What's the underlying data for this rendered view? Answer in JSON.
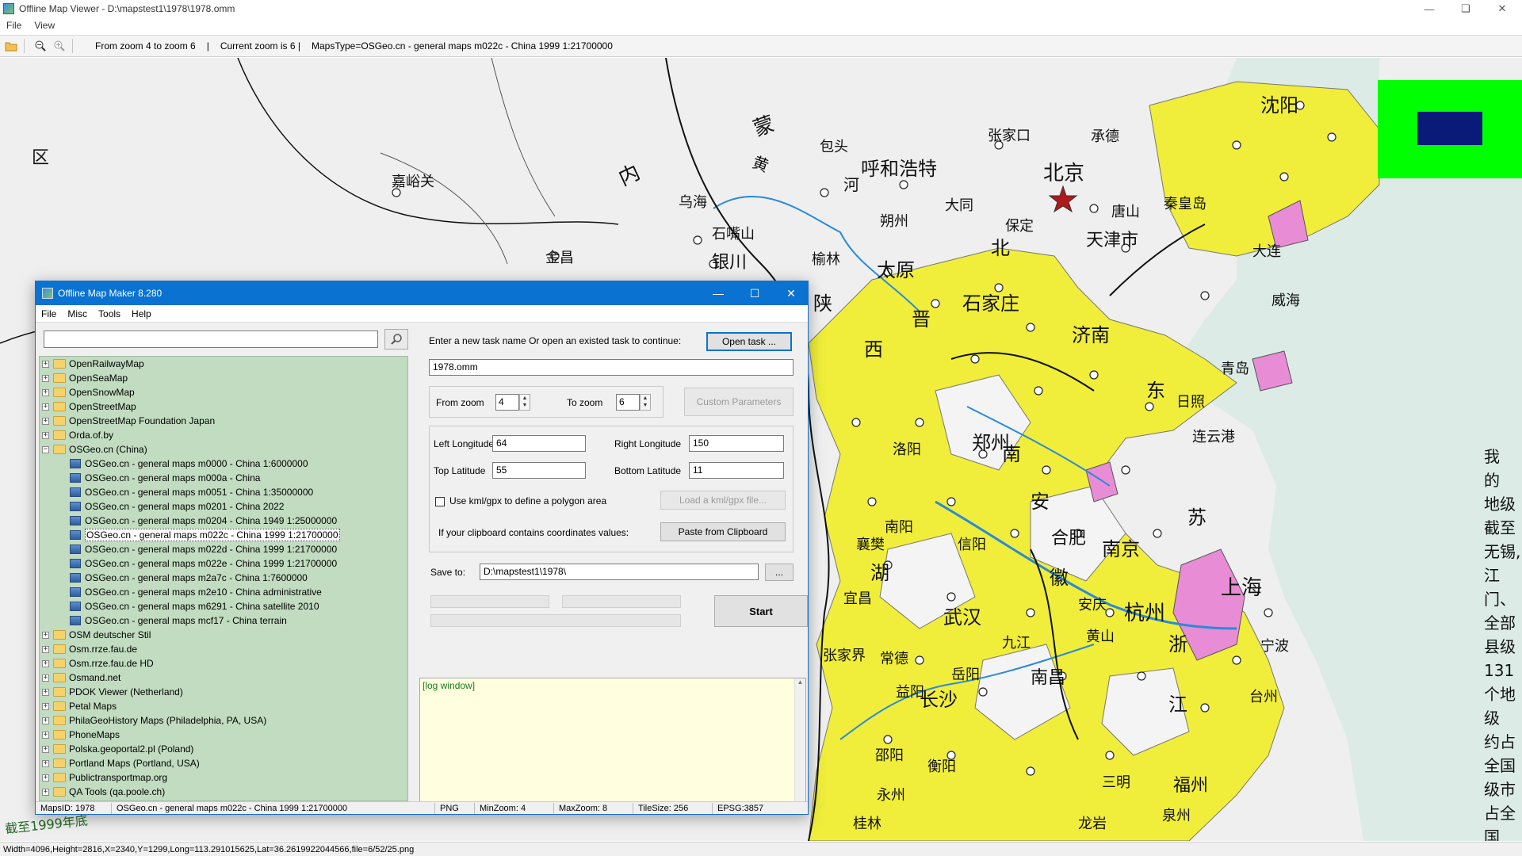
{
  "window": {
    "title": "Offline Map Viewer - D:\\mapstest1\\1978\\1978.omm",
    "menu": [
      "File",
      "View"
    ]
  },
  "toolbar": {
    "icons": [
      "open-folder-icon",
      "zoom-out-icon",
      "zoom-in-icon"
    ],
    "zoom_range": "From zoom 4 to zoom 6",
    "current_zoom": "Current zoom is 6 |",
    "maps_type": "MapsType=OSGeo.cn - general maps m022c - China 1999 1:21700000"
  },
  "map": {
    "labels": [
      "呼和浩特",
      "北京",
      "天津市",
      "石家庄",
      "济南",
      "太原",
      "郑州",
      "合肥",
      "南京",
      "上海",
      "杭州",
      "武汉",
      "长沙",
      "南昌",
      "福州",
      "沈阳",
      "银川",
      "乌海",
      "包头",
      "大同",
      "张家口",
      "承德",
      "唐山",
      "秦皇岛",
      "保定",
      "青岛",
      "日照",
      "连云港",
      "威海",
      "南阳",
      "洛阳",
      "襄樊",
      "宜昌",
      "邵阳",
      "衡阳",
      "永州",
      "桂林",
      "泉州",
      "台州",
      "宁波",
      "大连",
      "黄",
      "河",
      "蒙",
      "内",
      "嘉峪关",
      "金昌",
      "石嘴山",
      "榆林",
      "朔州",
      "信阳",
      "安庆",
      "九江",
      "三明",
      "龙岩",
      "张家界",
      "常德",
      "益阳",
      "岳阳",
      "黄山",
      "苏",
      "浙",
      "江",
      "安",
      "徽",
      "湖",
      "北",
      "南",
      "西",
      "晋",
      "陕",
      "东",
      "区"
    ],
    "side_text": [
      "我",
      "的",
      "地级",
      "截至",
      "无锡,",
      "江门、",
      "全部县级",
      "131个地级",
      "约占全国",
      "级市占全国"
    ],
    "corner_note": "截至1999年底",
    "tile_colors": {
      "outer": "#00ff00",
      "inner": "#0a1a78"
    }
  },
  "status": "Width=4096,Height=2816,X=2340,Y=1299,Long=113.291015625,Lat=36.2619922044566,file=6/52/25.png",
  "dialog": {
    "title": "Offline Map Maker 8.280",
    "menu": [
      "File",
      "Misc",
      "Tools",
      "Help"
    ],
    "search": {
      "value": "",
      "placeholder": ""
    },
    "tree": [
      {
        "label": "OpenRailwayMap",
        "type": "folder",
        "expanded": false
      },
      {
        "label": "OpenSeaMap",
        "type": "folder",
        "expanded": false
      },
      {
        "label": "OpenSnowMap",
        "type": "folder",
        "expanded": false
      },
      {
        "label": "OpenStreetMap",
        "type": "folder",
        "expanded": false
      },
      {
        "label": "OpenStreetMap Foundation Japan",
        "type": "folder",
        "expanded": false
      },
      {
        "label": "Orda.of.by",
        "type": "folder",
        "expanded": false
      },
      {
        "label": "OSGeo.cn (China)",
        "type": "folder",
        "expanded": true
      },
      {
        "label": "OSGeo.cn - general maps m0000 - China 1:6000000",
        "type": "map"
      },
      {
        "label": "OSGeo.cn - general maps m000a - China",
        "type": "map"
      },
      {
        "label": "OSGeo.cn - general maps m0051 - China 1:35000000",
        "type": "map"
      },
      {
        "label": "OSGeo.cn - general maps m0201 - China 2022",
        "type": "map"
      },
      {
        "label": "OSGeo.cn - general maps m0204 - China 1949 1:25000000",
        "type": "map"
      },
      {
        "label": "OSGeo.cn - general maps m022c - China 1999 1:21700000",
        "type": "map",
        "selected": true
      },
      {
        "label": "OSGeo.cn - general maps m022d - China 1999 1:21700000",
        "type": "map"
      },
      {
        "label": "OSGeo.cn - general maps m022e - China 1999 1:21700000",
        "type": "map"
      },
      {
        "label": "OSGeo.cn - general maps m2a7c - China 1:7600000",
        "type": "map"
      },
      {
        "label": "OSGeo.cn - general maps m2e10 - China administrative",
        "type": "map"
      },
      {
        "label": "OSGeo.cn - general maps m6291 - China satellite 2010",
        "type": "map"
      },
      {
        "label": "OSGeo.cn - general maps mcf17 - China terrain",
        "type": "map"
      },
      {
        "label": "OSM deutscher Stil",
        "type": "folder",
        "expanded": false
      },
      {
        "label": "Osm.rrze.fau.de",
        "type": "folder",
        "expanded": false
      },
      {
        "label": "Osm.rrze.fau.de HD",
        "type": "folder",
        "expanded": false
      },
      {
        "label": "Osmand.net",
        "type": "folder",
        "expanded": false
      },
      {
        "label": "PDOK Viewer (Netherland)",
        "type": "folder",
        "expanded": false
      },
      {
        "label": "Petal Maps",
        "type": "folder",
        "expanded": false
      },
      {
        "label": "PhilaGeoHistory Maps (Philadelphia, PA, USA)",
        "type": "folder",
        "expanded": false
      },
      {
        "label": "PhoneMaps",
        "type": "folder",
        "expanded": false
      },
      {
        "label": "Polska.geoportal2.pl (Poland)",
        "type": "folder",
        "expanded": false
      },
      {
        "label": "Portland Maps (Portland, USA)",
        "type": "folder",
        "expanded": false
      },
      {
        "label": "Publictransportmap.org",
        "type": "folder",
        "expanded": false
      },
      {
        "label": "QA Tools (qa.poole.ch)",
        "type": "folder",
        "expanded": false
      }
    ],
    "task_prompt": "Enter a new task name Or open an existed task to continue:",
    "open_task_label": "Open task ...",
    "task_name": "1978.omm",
    "from_zoom_label": "From zoom",
    "from_zoom": "4",
    "to_zoom_label": "To zoom",
    "to_zoom": "6",
    "custom_params_label": "Custom Parameters",
    "left_lon_label": "Left Longitude",
    "left_lon": "64",
    "right_lon_label": "Right Longitude",
    "right_lon": "150",
    "top_lat_label": "Top Latitude",
    "top_lat": "55",
    "bottom_lat_label": "Bottom Latitude",
    "bottom_lat": "11",
    "kml_label": "Use kml/gpx to define a polygon area",
    "load_kml_label": "Load a kml/gpx file...",
    "clipboard_prompt": "If your clipboard contains coordinates values:",
    "paste_label": "Paste from Clipboard",
    "save_to_label": "Save to:",
    "save_to": "D:\\mapstest1\\1978\\",
    "browse_label": "...",
    "start_label": "Start",
    "log_text": "[log window]",
    "status": {
      "maps_id": "MapsID: 1978",
      "map_name": "OSGeo.cn - general maps m022c - China 1999 1:21700000",
      "format": "PNG",
      "min_zoom": "MinZoom: 4",
      "max_zoom": "MaxZoom: 8",
      "tile_size": "TileSize: 256",
      "epsg": "EPSG:3857"
    }
  }
}
